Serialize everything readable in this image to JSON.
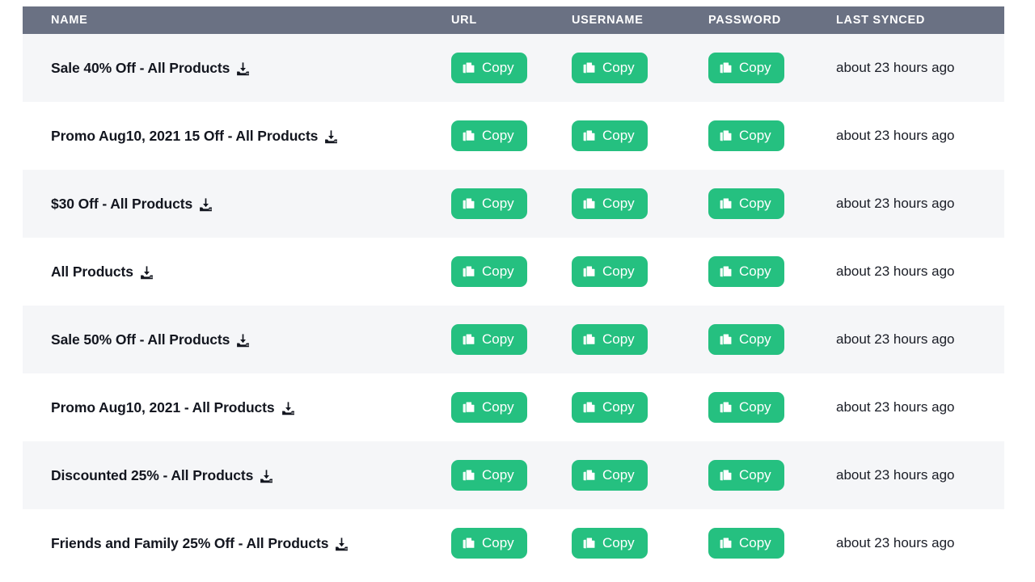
{
  "table": {
    "columns": [
      {
        "key": "name",
        "label": "NAME"
      },
      {
        "key": "url",
        "label": "URL"
      },
      {
        "key": "username",
        "label": "USERNAME"
      },
      {
        "key": "password",
        "label": "PASSWORD"
      },
      {
        "key": "synced",
        "label": "LAST SYNCED"
      }
    ],
    "header_background": "#6a7183",
    "header_text_color": "#ffffff",
    "row_alt_background": "#f5f6f8",
    "row_base_background": "#ffffff",
    "copy_button_color": "#25c080",
    "copy_label": "Copy",
    "name_icon": "download-icon",
    "action_icon": "copy-icon",
    "rows": [
      {
        "name": "Sale 40% Off - All Products",
        "url_action": "Copy",
        "username_action": "Copy",
        "password_action": "Copy",
        "synced": "about 23 hours ago"
      },
      {
        "name": "Promo Aug10, 2021 15 Off - All Products",
        "url_action": "Copy",
        "username_action": "Copy",
        "password_action": "Copy",
        "synced": "about 23 hours ago"
      },
      {
        "name": "$30 Off - All Products",
        "url_action": "Copy",
        "username_action": "Copy",
        "password_action": "Copy",
        "synced": "about 23 hours ago"
      },
      {
        "name": "All Products",
        "url_action": "Copy",
        "username_action": "Copy",
        "password_action": "Copy",
        "synced": "about 23 hours ago"
      },
      {
        "name": "Sale 50% Off - All Products",
        "url_action": "Copy",
        "username_action": "Copy",
        "password_action": "Copy",
        "synced": "about 23 hours ago"
      },
      {
        "name": "Promo Aug10, 2021 - All Products",
        "url_action": "Copy",
        "username_action": "Copy",
        "password_action": "Copy",
        "synced": "about 23 hours ago"
      },
      {
        "name": "Discounted 25% - All Products",
        "url_action": "Copy",
        "username_action": "Copy",
        "password_action": "Copy",
        "synced": "about 23 hours ago"
      },
      {
        "name": "Friends and Family 25% Off - All Products",
        "url_action": "Copy",
        "username_action": "Copy",
        "password_action": "Copy",
        "synced": "about 23 hours ago"
      }
    ]
  }
}
